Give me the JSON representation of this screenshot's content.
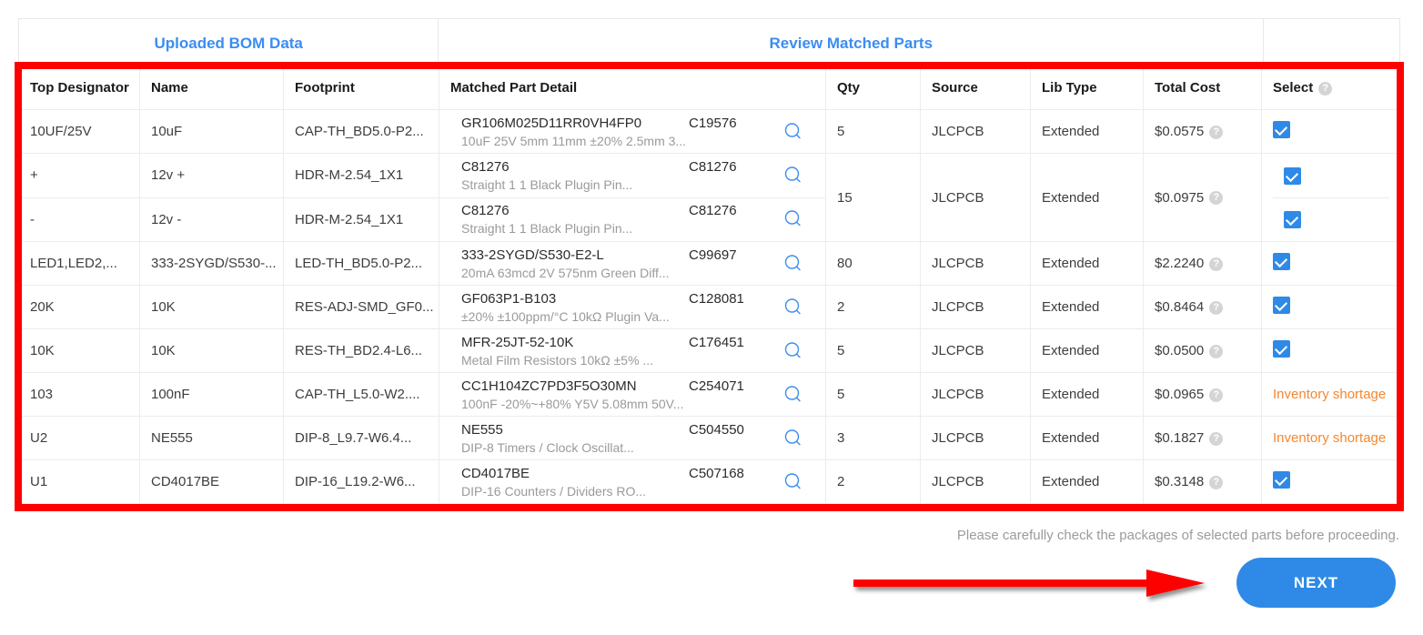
{
  "steps": [
    {
      "label": "Uploaded BOM Data"
    },
    {
      "label": "Review Matched Parts"
    },
    {
      "label": ""
    }
  ],
  "table": {
    "columns": [
      {
        "key": "designator",
        "label": "Top Designator"
      },
      {
        "key": "name",
        "label": "Name"
      },
      {
        "key": "footprint",
        "label": "Footprint"
      },
      {
        "key": "matched",
        "label": "Matched Part Detail"
      },
      {
        "key": "qty",
        "label": "Qty"
      },
      {
        "key": "source",
        "label": "Source"
      },
      {
        "key": "libtype",
        "label": "Lib Type"
      },
      {
        "key": "cost",
        "label": "Total Cost"
      },
      {
        "key": "select",
        "label": "Select"
      }
    ],
    "select_header_icon": "?",
    "rows": [
      {
        "designator": "10UF/25V",
        "name": "10uF",
        "footprint": "CAP-TH_BD5.0-P2...",
        "part_title": "GR106M025D11RR0VH4FP0",
        "part_code": "C19576",
        "part_desc": "10uF 25V 5mm 11mm ±20% 2.5mm 3...",
        "qty": "5",
        "source": "JLCPCB",
        "libtype": "Extended",
        "cost": "$0.0575",
        "select_state": "checked"
      },
      {
        "designator": "+",
        "name": "12v +",
        "footprint": "HDR-M-2.54_1X1",
        "part_title": "C81276",
        "part_code": "C81276",
        "part_desc": "Straight 1 1 Black Plugin Pin...",
        "qty": "15",
        "source": "JLCPCB",
        "libtype": "Extended",
        "cost": "$0.0975",
        "select_state": "checked"
      },
      {
        "designator": "-",
        "name": "12v -",
        "footprint": "HDR-M-2.54_1X1",
        "part_title": "C81276",
        "part_code": "C81276",
        "part_desc": "Straight 1 1 Black Plugin Pin...",
        "qty": "",
        "source": "",
        "libtype": "",
        "cost": "",
        "select_state": "checked"
      },
      {
        "designator": "LED1,LED2,...",
        "name": "333-2SYGD/S530-...",
        "footprint": "LED-TH_BD5.0-P2...",
        "part_title": "333-2SYGD/S530-E2-L",
        "part_code": "C99697",
        "part_desc": "20mA 63mcd 2V 575nm Green Diff...",
        "qty": "80",
        "source": "JLCPCB",
        "libtype": "Extended",
        "cost": "$2.2240",
        "select_state": "checked"
      },
      {
        "designator": "20K",
        "name": "10K",
        "footprint": "RES-ADJ-SMD_GF0...",
        "part_title": "GF063P1-B103",
        "part_code": "C128081",
        "part_desc": "±20% ±100ppm/°C 10kΩ Plugin Va...",
        "qty": "2",
        "source": "JLCPCB",
        "libtype": "Extended",
        "cost": "$0.8464",
        "select_state": "checked"
      },
      {
        "designator": "10K",
        "name": "10K",
        "footprint": "RES-TH_BD2.4-L6...",
        "part_title": "MFR-25JT-52-10K",
        "part_code": "C176451",
        "part_desc": "Metal Film Resistors 10kΩ ±5% ...",
        "qty": "5",
        "source": "JLCPCB",
        "libtype": "Extended",
        "cost": "$0.0500",
        "select_state": "checked"
      },
      {
        "designator": "103",
        "name": "100nF",
        "footprint": "CAP-TH_L5.0-W2....",
        "part_title": "CC1H104ZC7PD3F5O30MN",
        "part_code": "C254071",
        "part_desc": "100nF -20%~+80% Y5V 5.08mm 50V...",
        "qty": "5",
        "source": "JLCPCB",
        "libtype": "Extended",
        "cost": "$0.0965",
        "select_state": "shortage",
        "select_text": "Inventory shortage"
      },
      {
        "designator": "U2",
        "name": "NE555",
        "footprint": "DIP-8_L9.7-W6.4...",
        "part_title": "NE555",
        "part_code": "C504550",
        "part_desc": "DIP-8 Timers / Clock Oscillat...",
        "qty": "3",
        "source": "JLCPCB",
        "libtype": "Extended",
        "cost": "$0.1827",
        "select_state": "shortage",
        "select_text": "Inventory shortage"
      },
      {
        "designator": "U1",
        "name": "CD4017BE",
        "footprint": "DIP-16_L19.2-W6...",
        "part_title": "CD4017BE",
        "part_code": "C507168",
        "part_desc": "DIP-16 Counters / Dividers RO...",
        "qty": "2",
        "source": "JLCPCB",
        "libtype": "Extended",
        "cost": "$0.3148",
        "select_state": "checked"
      }
    ]
  },
  "footer": {
    "note": "Please carefully check the packages of selected parts before proceeding.",
    "next_label": "NEXT"
  },
  "colors": {
    "accent_blue": "#2e8ae6",
    "step_blue": "#3b8df0",
    "highlight_red": "#fd0000",
    "shortage_orange": "#f5872e",
    "muted_gray": "#9a9a9a"
  }
}
